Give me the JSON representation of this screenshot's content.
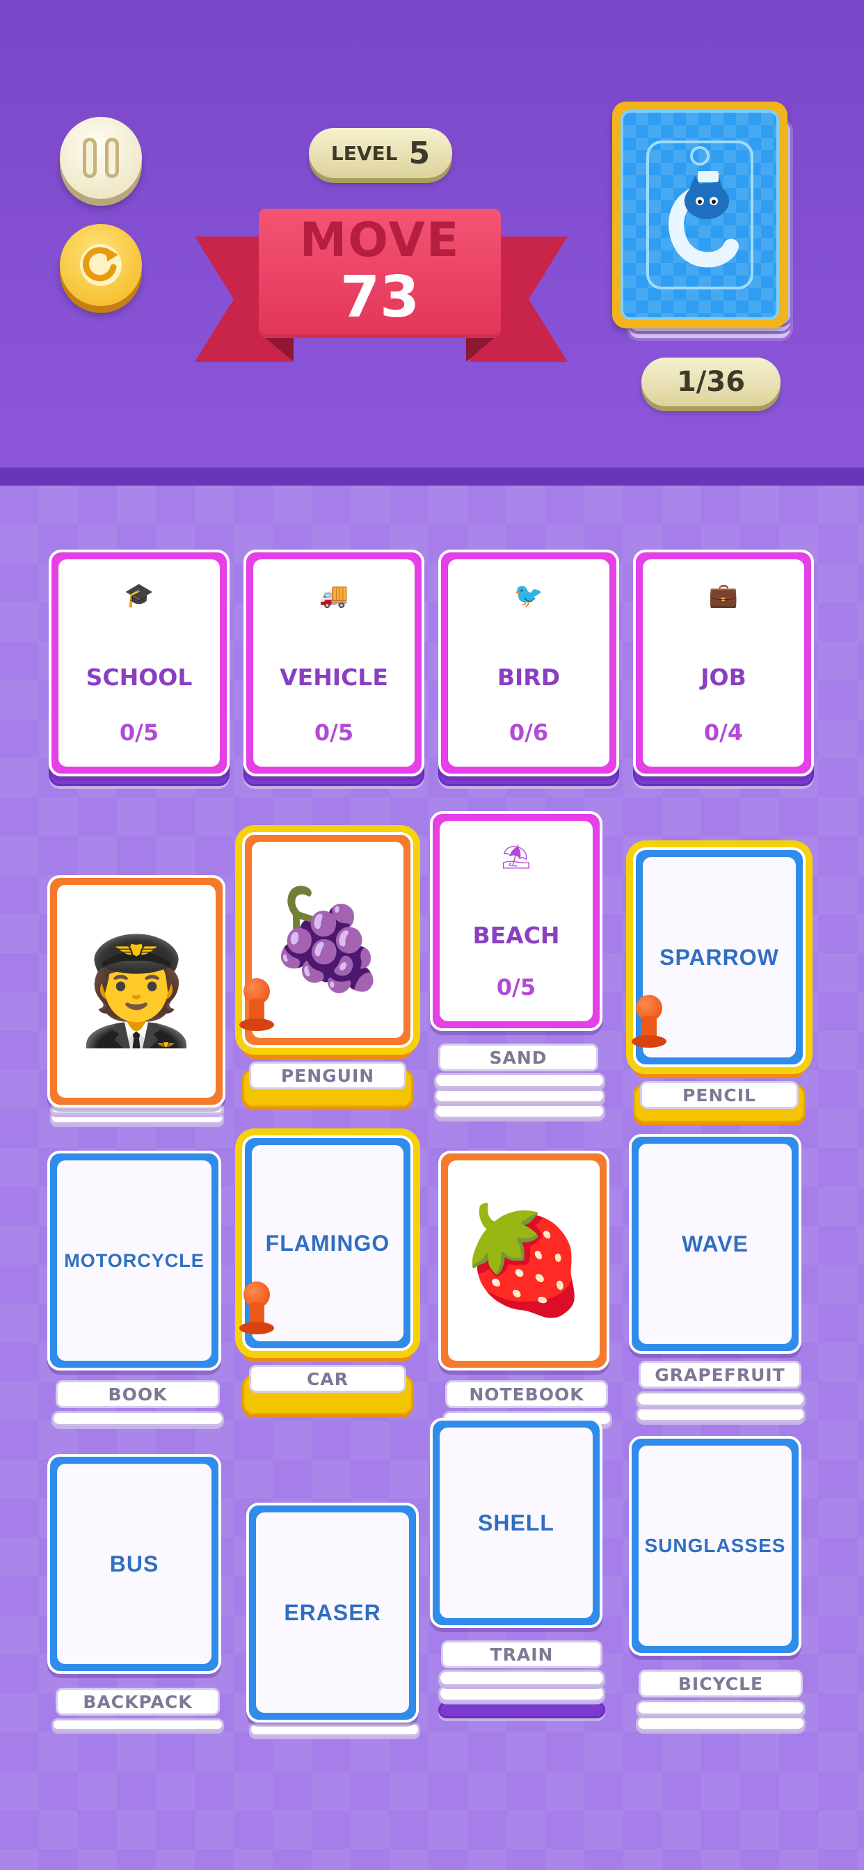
{
  "hud": {
    "level_label": "LEVEL",
    "level_number": "5",
    "move_label": "MOVE",
    "move_number": "73",
    "deck_count": "1/36",
    "pause_icon": "pause-icon",
    "restart_icon": "restart-icon"
  },
  "category_slots": [
    {
      "icon": "graduation-cap-icon",
      "glyph": "🎓",
      "title": "SCHOOL",
      "count": "0/5"
    },
    {
      "icon": "truck-icon",
      "glyph": "🚚",
      "title": "VEHICLE",
      "count": "0/5"
    },
    {
      "icon": "bird-icon",
      "glyph": "🐦",
      "title": "BIRD",
      "count": "0/6"
    },
    {
      "icon": "briefcase-icon",
      "glyph": "💼",
      "title": "JOB",
      "count": "0/4"
    }
  ],
  "tableau": {
    "col1_row1": {
      "image": "pilot-image",
      "emoji": "🧑‍✈️"
    },
    "col2_row1": {
      "image": "grapes-image",
      "emoji": "🍇",
      "under": "PENGUIN"
    },
    "col3_row1": {
      "icon": "beach-umbrella-icon",
      "glyph": "⛱",
      "title": "BEACH",
      "count": "0/5",
      "under": "SAND"
    },
    "col4_row1": {
      "word": "SPARROW",
      "under": "PENCIL"
    },
    "col1_row2": {
      "word": "MOTORCYCLE",
      "under": "BOOK"
    },
    "col2_row2": {
      "word": "FLAMINGO",
      "under": "CAR"
    },
    "col3_row2": {
      "image": "strawberry-image",
      "emoji": "🍓",
      "under": "NOTEBOOK"
    },
    "col4_row2": {
      "word": "WAVE",
      "under": "GRAPEFRUIT"
    },
    "col1_row3": {
      "word": "BUS",
      "under": "BACKPACK"
    },
    "col2_row3": {
      "word": "ERASER"
    },
    "col3_row3": {
      "word": "SHELL",
      "under": "TRAIN"
    },
    "col4_row3": {
      "word": "SUNGLASSES",
      "under": "BICYCLE"
    }
  },
  "colors": {
    "header": "#7a47c9",
    "board": "#a57ee9",
    "category_border": "#e53fe8",
    "word_card_border": "#2f8cea",
    "image_card_border": "#f57a2c",
    "selected_highlight": "#f6d10a",
    "ribbon": "#e23558"
  }
}
